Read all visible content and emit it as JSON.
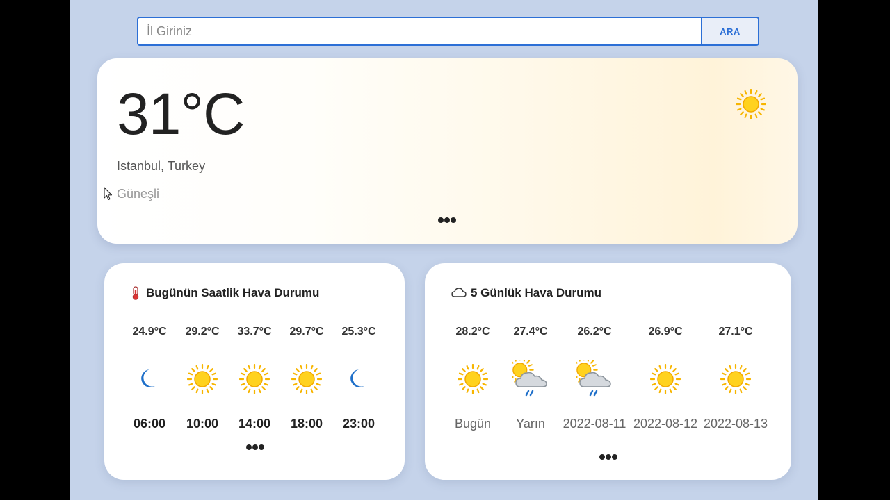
{
  "search": {
    "placeholder": "İl Giriniz",
    "button_label": "ARA"
  },
  "current": {
    "temperature": "31°C",
    "location": "Istanbul, Turkey",
    "condition": "Güneşli",
    "icon": "sun-icon"
  },
  "hourly": {
    "title": "Bugünün Saatlik Hava Durumu",
    "title_icon": "thermometer-icon",
    "items": [
      {
        "temp": "24.9°C",
        "icon": "moon-icon",
        "time": "06:00"
      },
      {
        "temp": "29.2°C",
        "icon": "sun-icon",
        "time": "10:00"
      },
      {
        "temp": "33.7°C",
        "icon": "sun-icon",
        "time": "14:00"
      },
      {
        "temp": "29.7°C",
        "icon": "sun-icon",
        "time": "18:00"
      },
      {
        "temp": "25.3°C",
        "icon": "moon-icon",
        "time": "23:00"
      }
    ]
  },
  "daily": {
    "title": "5 Günlük Hava Durumu",
    "title_icon": "cloud-icon",
    "items": [
      {
        "temp": "28.2°C",
        "icon": "sun-icon",
        "day": "Bugün"
      },
      {
        "temp": "27.4°C",
        "icon": "sun-rain-cloud-icon",
        "day": "Yarın"
      },
      {
        "temp": "26.2°C",
        "icon": "sun-rain-cloud-icon",
        "day": "2022-08-11"
      },
      {
        "temp": "26.9°C",
        "icon": "sun-icon",
        "day": "2022-08-12"
      },
      {
        "temp": "27.1°C",
        "icon": "sun-icon",
        "day": "2022-08-13"
      }
    ]
  },
  "colors": {
    "accent": "#2c6fd6",
    "background": "#c5d3ea",
    "sun": "#ffc107",
    "moon": "#1e6fc9"
  }
}
